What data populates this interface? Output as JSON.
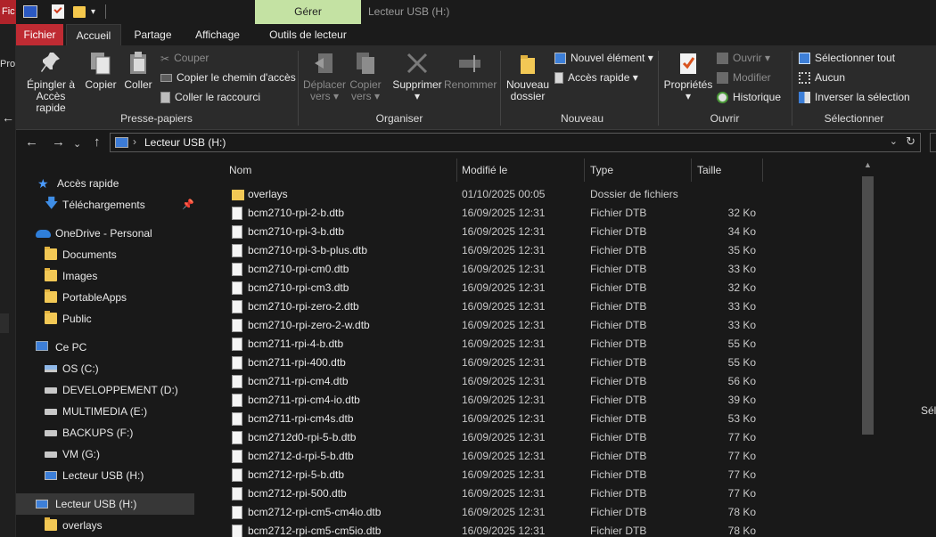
{
  "background": {
    "left_tab": "Fic",
    "left_text": "Pro",
    "right_text": "Sél"
  },
  "titlebar": {
    "context_tab": "Gérer",
    "window_title": "Lecteur USB (H:)"
  },
  "tabs": [
    "Fichier",
    "Accueil",
    "Partage",
    "Affichage",
    "Outils de lecteur"
  ],
  "ribbon": {
    "presse_papiers": {
      "label": "Presse-papiers",
      "pin": "Épingler à\nAccès rapide",
      "pin_l1": "Épingler à",
      "pin_l2": "Accès rapide",
      "copy": "Copier",
      "paste": "Coller",
      "cut": "Couper",
      "copy_path": "Copier le chemin d'accès",
      "paste_shortcut": "Coller le raccourci"
    },
    "organiser": {
      "label": "Organiser",
      "move_l1": "Déplacer",
      "move_l2": "vers",
      "copyto_l1": "Copier",
      "copyto_l2": "vers",
      "delete": "Supprimer",
      "rename": "Renommer"
    },
    "nouveau": {
      "label": "Nouveau",
      "new_folder_l1": "Nouveau",
      "new_folder_l2": "dossier",
      "new_item": "Nouvel élément",
      "quick_access": "Accès rapide"
    },
    "ouvrir": {
      "label": "Ouvrir",
      "properties": "Propriétés",
      "open": "Ouvrir",
      "edit": "Modifier",
      "history": "Historique"
    },
    "selection": {
      "label": "Sélectionner",
      "select_all": "Sélectionner tout",
      "none": "Aucun",
      "invert": "Inverser la sélection"
    }
  },
  "address": {
    "path": "Lecteur USB (H:)"
  },
  "nav": [
    {
      "label": "Accès rapide",
      "icon": "star-icon"
    },
    {
      "label": "Téléchargements",
      "icon": "download-icon"
    },
    {
      "label": "OneDrive - Personal",
      "icon": "cloud-icon"
    },
    {
      "label": "Documents",
      "icon": "folder-icon"
    },
    {
      "label": "Images",
      "icon": "folder-icon"
    },
    {
      "label": "PortableApps",
      "icon": "folder-icon"
    },
    {
      "label": "Public",
      "icon": "folder-icon"
    },
    {
      "label": "Ce PC",
      "icon": "computer-icon"
    },
    {
      "label": "OS (C:)",
      "icon": "drive-icon"
    },
    {
      "label": "DEVELOPPEMENT (D:)",
      "icon": "drive-icon"
    },
    {
      "label": "MULTIMEDIA (E:)",
      "icon": "drive-icon"
    },
    {
      "label": "BACKUPS (F:)",
      "icon": "drive-icon"
    },
    {
      "label": "VM (G:)",
      "icon": "drive-icon"
    },
    {
      "label": "Lecteur USB (H:)",
      "icon": "usb-drive-icon"
    },
    {
      "label": "Lecteur USB (H:)",
      "icon": "usb-drive-icon"
    },
    {
      "label": "overlays",
      "icon": "folder-icon"
    }
  ],
  "columns": {
    "name": "Nom",
    "modified": "Modifié le",
    "type": "Type",
    "size": "Taille"
  },
  "files": [
    {
      "name": "overlays",
      "modified": "01/10/2025 00:05",
      "type": "Dossier de fichiers",
      "size": "",
      "kind": "folder"
    },
    {
      "name": "bcm2710-rpi-2-b.dtb",
      "modified": "16/09/2025 12:31",
      "type": "Fichier DTB",
      "size": "32 Ko",
      "kind": "file"
    },
    {
      "name": "bcm2710-rpi-3-b.dtb",
      "modified": "16/09/2025 12:31",
      "type": "Fichier DTB",
      "size": "34 Ko",
      "kind": "file"
    },
    {
      "name": "bcm2710-rpi-3-b-plus.dtb",
      "modified": "16/09/2025 12:31",
      "type": "Fichier DTB",
      "size": "35 Ko",
      "kind": "file"
    },
    {
      "name": "bcm2710-rpi-cm0.dtb",
      "modified": "16/09/2025 12:31",
      "type": "Fichier DTB",
      "size": "33 Ko",
      "kind": "file"
    },
    {
      "name": "bcm2710-rpi-cm3.dtb",
      "modified": "16/09/2025 12:31",
      "type": "Fichier DTB",
      "size": "32 Ko",
      "kind": "file"
    },
    {
      "name": "bcm2710-rpi-zero-2.dtb",
      "modified": "16/09/2025 12:31",
      "type": "Fichier DTB",
      "size": "33 Ko",
      "kind": "file"
    },
    {
      "name": "bcm2710-rpi-zero-2-w.dtb",
      "modified": "16/09/2025 12:31",
      "type": "Fichier DTB",
      "size": "33 Ko",
      "kind": "file"
    },
    {
      "name": "bcm2711-rpi-4-b.dtb",
      "modified": "16/09/2025 12:31",
      "type": "Fichier DTB",
      "size": "55 Ko",
      "kind": "file"
    },
    {
      "name": "bcm2711-rpi-400.dtb",
      "modified": "16/09/2025 12:31",
      "type": "Fichier DTB",
      "size": "55 Ko",
      "kind": "file"
    },
    {
      "name": "bcm2711-rpi-cm4.dtb",
      "modified": "16/09/2025 12:31",
      "type": "Fichier DTB",
      "size": "56 Ko",
      "kind": "file"
    },
    {
      "name": "bcm2711-rpi-cm4-io.dtb",
      "modified": "16/09/2025 12:31",
      "type": "Fichier DTB",
      "size": "39 Ko",
      "kind": "file"
    },
    {
      "name": "bcm2711-rpi-cm4s.dtb",
      "modified": "16/09/2025 12:31",
      "type": "Fichier DTB",
      "size": "53 Ko",
      "kind": "file"
    },
    {
      "name": "bcm2712d0-rpi-5-b.dtb",
      "modified": "16/09/2025 12:31",
      "type": "Fichier DTB",
      "size": "77 Ko",
      "kind": "file"
    },
    {
      "name": "bcm2712-d-rpi-5-b.dtb",
      "modified": "16/09/2025 12:31",
      "type": "Fichier DTB",
      "size": "77 Ko",
      "kind": "file"
    },
    {
      "name": "bcm2712-rpi-5-b.dtb",
      "modified": "16/09/2025 12:31",
      "type": "Fichier DTB",
      "size": "77 Ko",
      "kind": "file"
    },
    {
      "name": "bcm2712-rpi-500.dtb",
      "modified": "16/09/2025 12:31",
      "type": "Fichier DTB",
      "size": "77 Ko",
      "kind": "file"
    },
    {
      "name": "bcm2712-rpi-cm5-cm4io.dtb",
      "modified": "16/09/2025 12:31",
      "type": "Fichier DTB",
      "size": "78 Ko",
      "kind": "file"
    },
    {
      "name": "bcm2712-rpi-cm5-cm5io.dtb",
      "modified": "16/09/2025 12:31",
      "type": "Fichier DTB",
      "size": "78 Ko",
      "kind": "file"
    }
  ],
  "colors": {
    "fichier_tab": "#bf2b33",
    "context_tab": "#c4e2a3",
    "folder": "#f2c855",
    "accent_blue": "#3d7fd8"
  }
}
